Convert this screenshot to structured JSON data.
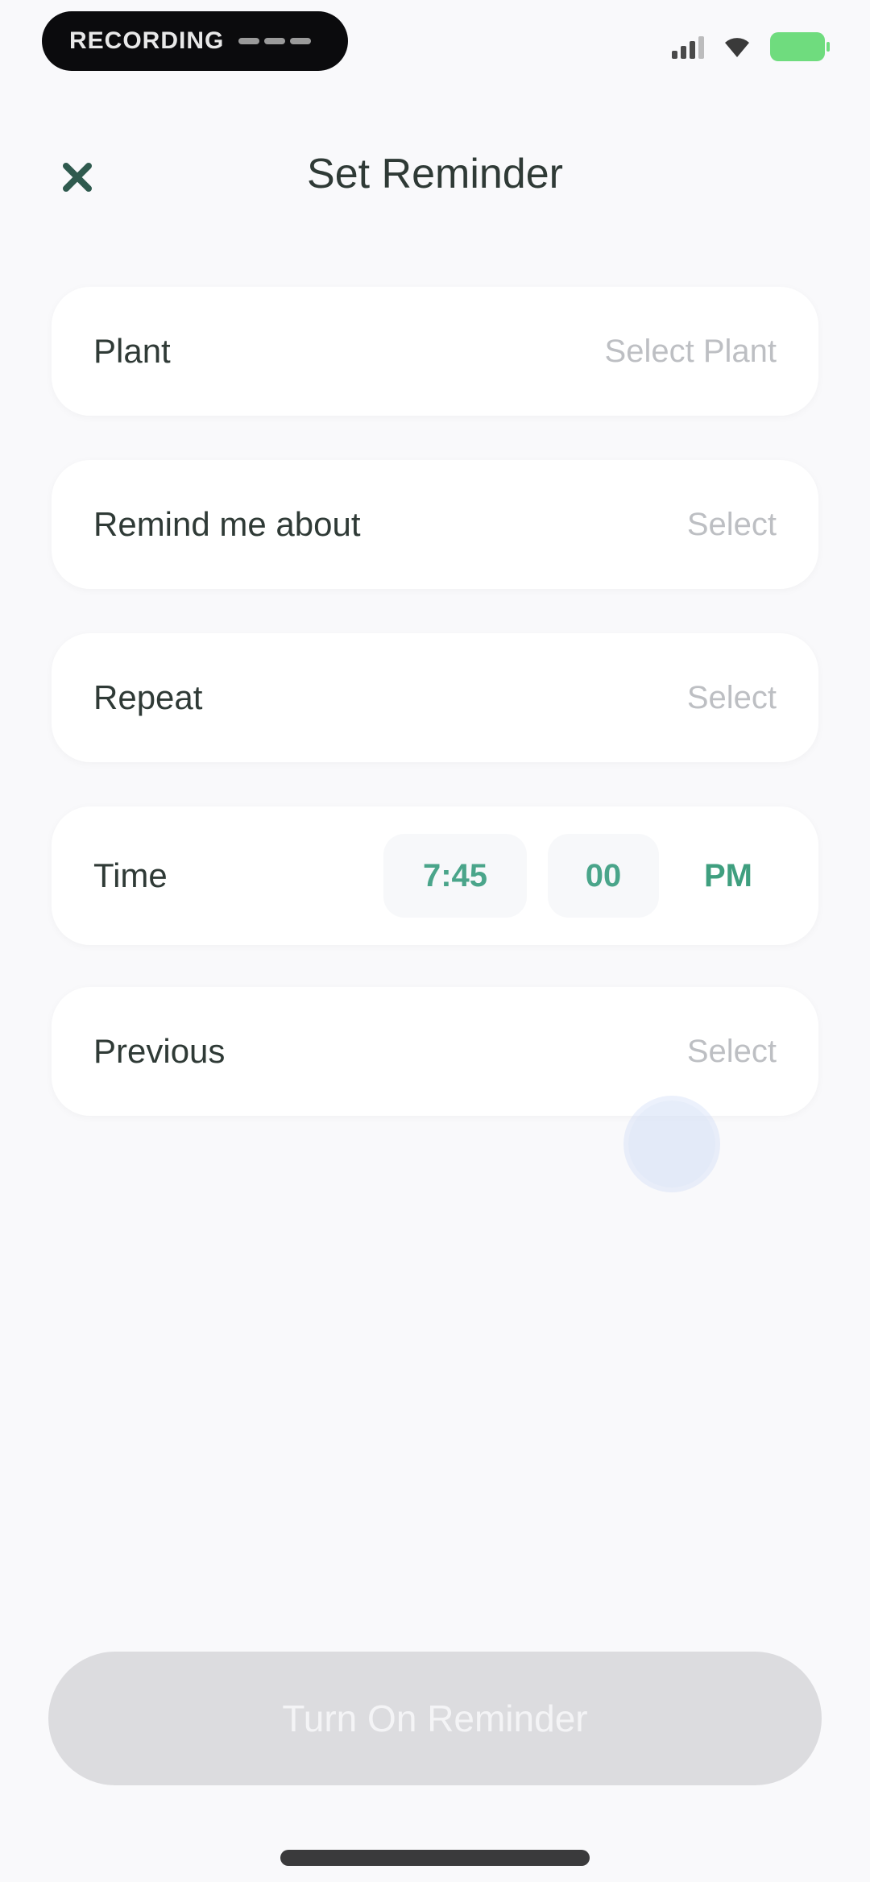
{
  "status_bar": {
    "recording_label": "RECORDING",
    "signal_icon": "signal-icon",
    "wifi_icon": "wifi-icon",
    "battery_icon": "battery-icon",
    "battery_color": "#6fdc7e"
  },
  "header": {
    "title": "Set Reminder",
    "close_icon": "close-icon"
  },
  "form": {
    "plant": {
      "label": "Plant",
      "value": "Select Plant"
    },
    "remind_about": {
      "label": "Remind me about",
      "value": "Select"
    },
    "repeat": {
      "label": "Repeat",
      "value": "Select"
    },
    "time": {
      "label": "Time",
      "hour": "7:45",
      "minute": "00",
      "period": "PM"
    },
    "previous": {
      "label": "Previous",
      "value": "Select"
    }
  },
  "footer": {
    "cta_label": "Turn On Reminder"
  },
  "colors": {
    "accent": "#4aa58a",
    "placeholder": "#bdbfc3",
    "disabled_button": "#dcdcdf",
    "background": "#f9f9fb"
  }
}
